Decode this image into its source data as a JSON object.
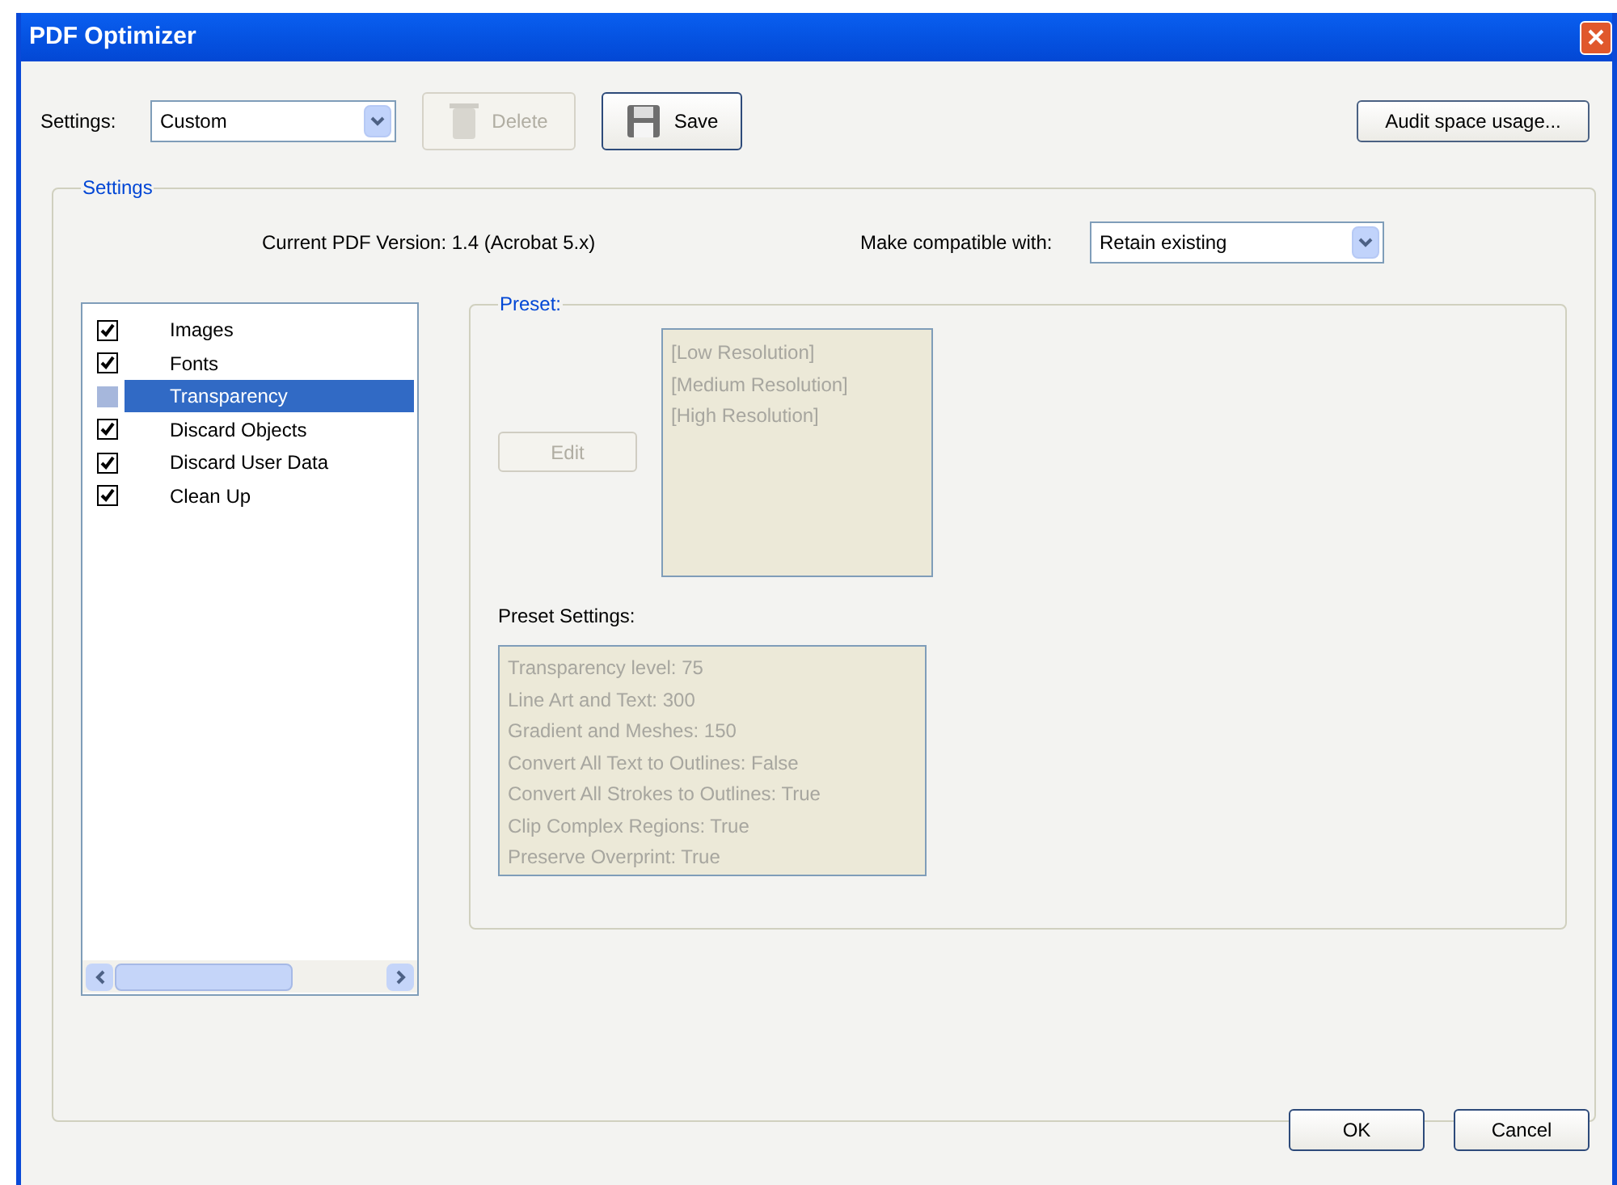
{
  "window": {
    "title": "PDF Optimizer"
  },
  "toolbar": {
    "settings_label": "Settings:",
    "settings_value": "Custom",
    "delete": {
      "label": "Delete",
      "disabled": true
    },
    "save": {
      "label": "Save",
      "disabled": false
    },
    "audit": "Audit space usage..."
  },
  "settings_group": {
    "title": "Settings",
    "current_version": "Current PDF Version: 1.4 (Acrobat 5.x)",
    "compatible_label": "Make compatible with:",
    "compatible_value": "Retain existing"
  },
  "panels": [
    {
      "label": "Images",
      "checked": true,
      "selected": false
    },
    {
      "label": "Fonts",
      "checked": true,
      "selected": false
    },
    {
      "label": "Transparency",
      "checked": false,
      "selected": true
    },
    {
      "label": "Discard Objects",
      "checked": true,
      "selected": false
    },
    {
      "label": "Discard User Data",
      "checked": true,
      "selected": false
    },
    {
      "label": "Clean Up",
      "checked": true,
      "selected": false
    }
  ],
  "preset": {
    "title": "Preset:",
    "edit": {
      "label": "Edit",
      "disabled": true
    },
    "disabled": true,
    "presets": [
      "[Low Resolution]",
      "[Medium Resolution]",
      "[High Resolution]"
    ],
    "settings_label": "Preset Settings:",
    "settings": [
      "Transparency level: 75",
      "Line Art and Text: 300",
      "Gradient and Meshes: 150",
      "Convert All Text to Outlines: False",
      "Convert All Strokes to Outlines: True",
      "Clip Complex Regions: True",
      "Preserve Overprint: True"
    ]
  },
  "buttons": [
    "OK",
    "Cancel"
  ]
}
